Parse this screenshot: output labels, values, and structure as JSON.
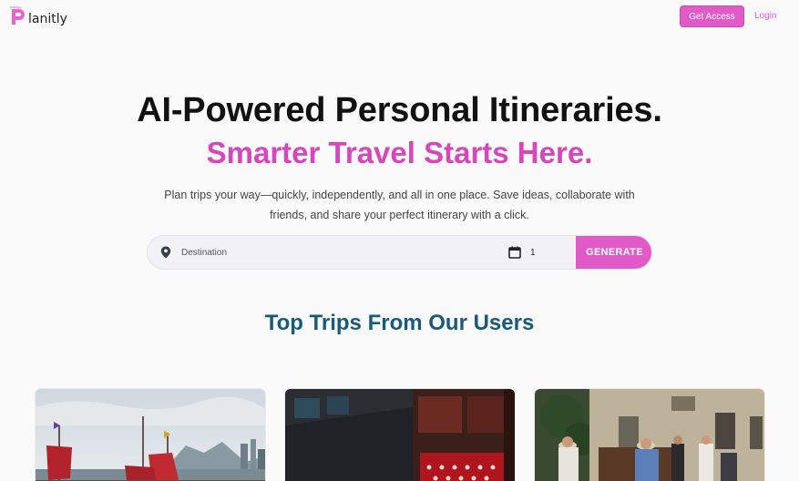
{
  "header": {
    "logo_text": "lanitly",
    "logo_icon": "planitly-p-logo",
    "get_access_label": "Get Access",
    "login_label": "Login"
  },
  "hero": {
    "title": "AI-Powered Personal Itineraries.",
    "subtitle": "Smarter Travel Starts Here.",
    "description": "Plan trips your way—quickly, independently, and all in one place. Save ideas, collaborate with friends, and share your perfect itinerary with a click."
  },
  "search": {
    "destination_placeholder": "Destination",
    "days_value": "1",
    "generate_label": "GENERATE",
    "destination_icon": "location-pin-icon",
    "days_icon": "calendar-icon"
  },
  "top_trips": {
    "title": "Top Trips From Our Users",
    "cards": [
      {
        "image": "harbor-junk-boat-photo"
      },
      {
        "image": "night-street-lights-photo"
      },
      {
        "image": "street-musicians-photo"
      }
    ]
  },
  "colors": {
    "accent": "#e05ac8",
    "subtitle_pink": "#d647b9",
    "section_title": "#185a7a",
    "background": "#fafafb"
  }
}
